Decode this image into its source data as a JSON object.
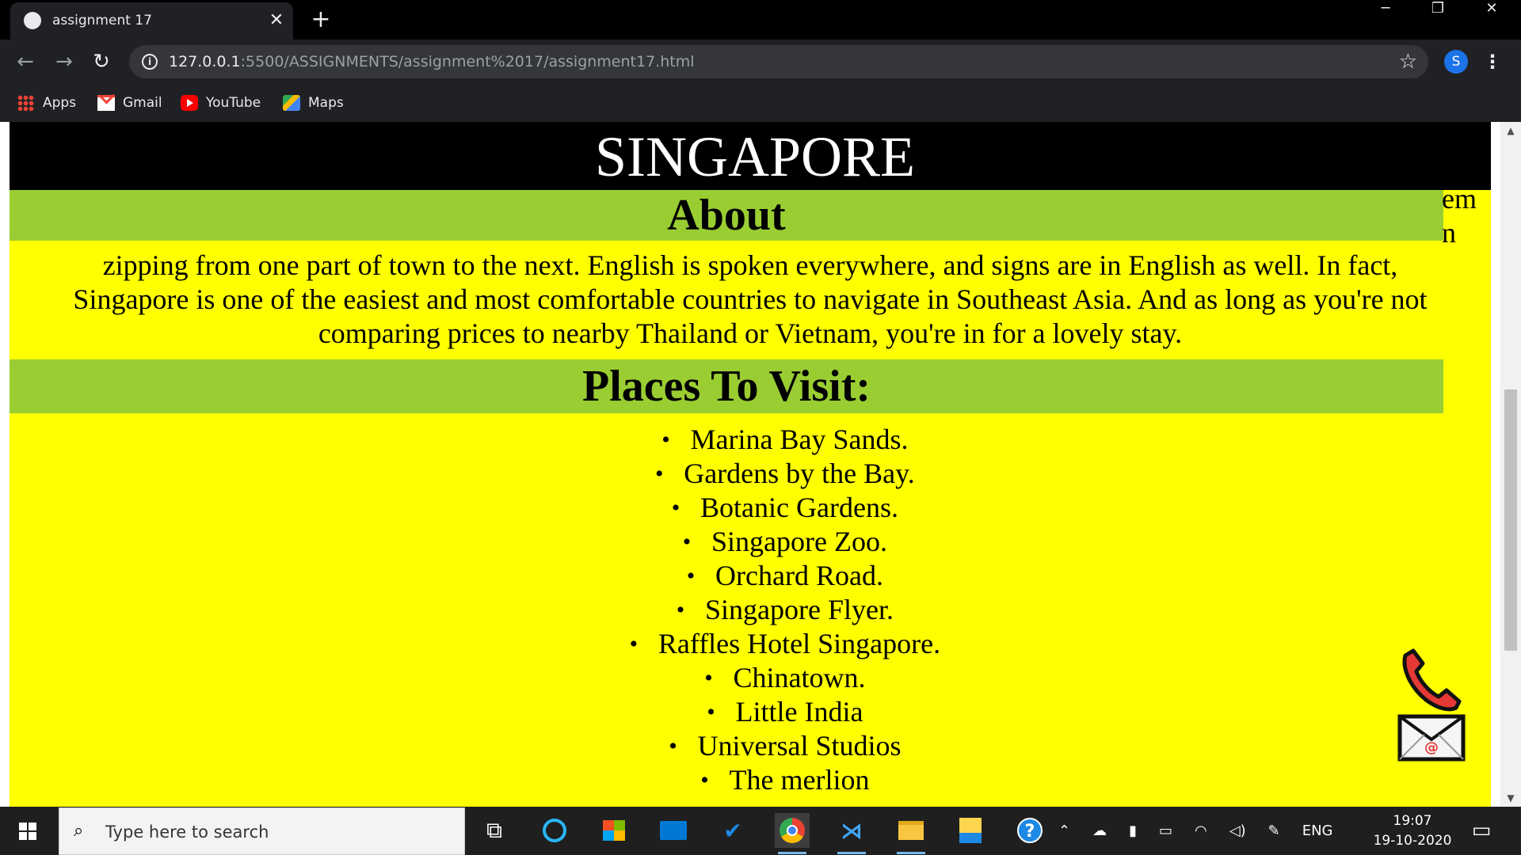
{
  "browser": {
    "tab_title": "assignment 17",
    "tab_close": "✕",
    "new_tab": "+",
    "url_host": "127.0.0.1",
    "url_rest": ":5500/ASSIGNMENTS/assignment%2017/assignment17.html",
    "profile_initial": "S",
    "window_controls": {
      "minimize": "─",
      "restore": "❐",
      "close": "✕"
    },
    "bookmarks": [
      {
        "label": "Apps",
        "icon": "apps-icon"
      },
      {
        "label": "Gmail",
        "icon": "gmail-icon"
      },
      {
        "label": "YouTube",
        "icon": "youtube-icon"
      },
      {
        "label": "Maps",
        "icon": "maps-icon"
      }
    ]
  },
  "page": {
    "title": "SINGAPORE",
    "about_heading": "About",
    "about_overflow_line1": "em",
    "about_overflow_line2": "n",
    "about_lines": [
      "zipping from one part of town to the next. English is spoken everywhere, and signs are in English as well. In fact,",
      "Singapore is one of the easiest and most comfortable countries to navigate in Southeast Asia. And as long as you're not",
      "comparing prices to nearby Thailand or Vietnam, you're in for a lovely stay."
    ],
    "places_heading": "Places To Visit:",
    "places": [
      "Marina Bay Sands.",
      "Gardens by the Bay.",
      "Botanic Gardens.",
      "Singapore Zoo.",
      "Orchard Road.",
      "Singapore Flyer.",
      "Raffles Hotel Singapore.",
      "Chinatown.",
      "Little India",
      "Universal Studios",
      "The merlion"
    ],
    "bullet": "•"
  },
  "taskbar": {
    "search_placeholder": "Type here to search",
    "language": "ENG",
    "time": "19:07",
    "date": "19-10-2020"
  },
  "colors": {
    "page_background": "#ffff00",
    "heading_bar": "#9acd32",
    "header_background": "#000000"
  }
}
